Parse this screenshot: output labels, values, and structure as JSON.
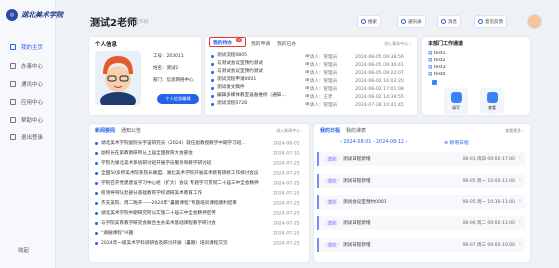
{
  "sidebar": {
    "logo_text": "湖北美术学院",
    "items": [
      {
        "label": "我的主页",
        "icon": "home-icon",
        "active": true
      },
      {
        "label": "办事中心",
        "icon": "briefcase-icon"
      },
      {
        "label": "通讯中心",
        "icon": "message-icon"
      },
      {
        "label": "应用中心",
        "icon": "grid-icon"
      },
      {
        "label": "帮助中心",
        "icon": "help-icon"
      },
      {
        "label": "退出登录",
        "icon": "logout-icon"
      }
    ],
    "collapse_label": "收起"
  },
  "header": {
    "greeting": "测试2老师",
    "period": "上午好",
    "buttons": [
      {
        "label": "搜索",
        "icon": "search-icon"
      },
      {
        "label": "通讯录",
        "icon": "contacts-icon"
      },
      {
        "label": "消息",
        "icon": "bell-icon"
      },
      {
        "label": "意见反馈",
        "icon": "feedback-icon"
      }
    ]
  },
  "profile": {
    "title": "个人信息",
    "fields": [
      {
        "label": "工号：",
        "value": "203011"
      },
      {
        "label": "姓名：",
        "value": "测试2"
      },
      {
        "label": "部门：",
        "value": "信息网络中心"
      }
    ],
    "button_label": "个人信息编辑"
  },
  "tasks": {
    "tabs": [
      {
        "label": "我的待办",
        "badge": "10"
      },
      {
        "label": "我的申请"
      },
      {
        "label": "我的已办"
      }
    ],
    "more": "进入事务中心 ›",
    "rows": [
      {
        "title": "测试流程0805",
        "applicant": "申请人：管理员",
        "date": "2024-08-05 09:38:56"
      },
      {
        "title": "与测试会议室预约测试",
        "applicant": "申请人：管理员",
        "date": "2024-08-05 09:30:41"
      },
      {
        "title": "与测试会议室预约测试",
        "applicant": "申请人：管理员",
        "date": "2024-08-05 09:22:07"
      },
      {
        "title": "测试流程申请0001",
        "applicant": "申请人：管理员",
        "date": "2024-08-02 16:02:20"
      },
      {
        "title": "测试发文稿件",
        "applicant": "申请人：管理员",
        "date": "2024-08-02 17:01:08"
      },
      {
        "title": "编辑多媒体教室设备维修（通知…",
        "applicant": "申请人：王老",
        "date": "2024-08-02 14:39:55"
      },
      {
        "title": "测试流程0728",
        "applicant": "申请人：管理员",
        "date": "2024-07-28 10:41:45"
      }
    ]
  },
  "workbench": {
    "title": "本部门工作通道",
    "items": [
      "test1",
      "test2",
      "test3",
      "test4"
    ],
    "tiles": [
      {
        "label": "填写"
      },
      {
        "label": "查看"
      }
    ]
  },
  "news": {
    "tabs": [
      "新闻要闻",
      "通知公告"
    ],
    "more": "进入新闻中心 ›",
    "rows": [
      {
        "title": "湖北美术学院副院长宇宙研究员（2024）就任副教授教学中期学习班…",
        "date": "2024-08-01"
      },
      {
        "title": "副校长在第教教研所从上届全国教育大会部会",
        "date": "2024-07-31"
      },
      {
        "title": "学院为湖北美术系统研讨班开展学员服务和教学研讨班",
        "date": "2024-07-25"
      },
      {
        "title": "全国50多所美术院系院长联盟、湖北美术学院开展美术教育研修工作探讨会议",
        "date": "2024-07-25"
      },
      {
        "title": "学院召开党建建设学习中心组（扩大）会议 专题学习贯彻二十届三中全会精神",
        "date": "2024-07-25"
      },
      {
        "title": "校领导带队赴部分基础教育学校调研美术教育工作",
        "date": "2024-07-25"
      },
      {
        "title": "杰夫美院、周二晚开——2024年“暑期课程”专题培训课程顺利结束",
        "date": "2024-07-25"
      },
      {
        "title": "湖北美术学院中期研究所以实施二十届三中全会精神宣传",
        "date": "2024-07-25"
      },
      {
        "title": "与学院美育教学研究会联合主办美术基础课程教学研讨会",
        "date": "2024-07-25"
      },
      {
        "title": "“湖融课程”兴趣",
        "date": "2024-07-25"
      },
      {
        "title": "2024年一级美术学科调研会及研讨开展（暑期）培训课程交流",
        "date": "2024-07-25"
      }
    ]
  },
  "schedule": {
    "title": "我的日程",
    "tab2": "我的课表",
    "more": "查看更多 ›",
    "range": "2024-08-01 - 2024-08-12",
    "add_label": "⊕ 新增日程",
    "events": [
      {
        "tag": "会议",
        "name": "测试日程新增",
        "time": "08-01 周四 09:00-17:00"
      },
      {
        "tag": "会议",
        "name": "测试日程新增",
        "time": "08-05 周一 10:00-11:00"
      },
      {
        "tag": "会议",
        "name": "测试会议室预约0001",
        "time": "08-05 周一 10:30-11:00"
      },
      {
        "tag": "会议",
        "name": "测试日程新增",
        "time": "08-06 周二 09:00-11:00"
      },
      {
        "tag": "会议",
        "name": "测试日程新增",
        "time": "08-07 周三 09:00-10:00"
      }
    ]
  },
  "colors": {
    "accent": "#2563eb",
    "highlight": "#e53935"
  }
}
